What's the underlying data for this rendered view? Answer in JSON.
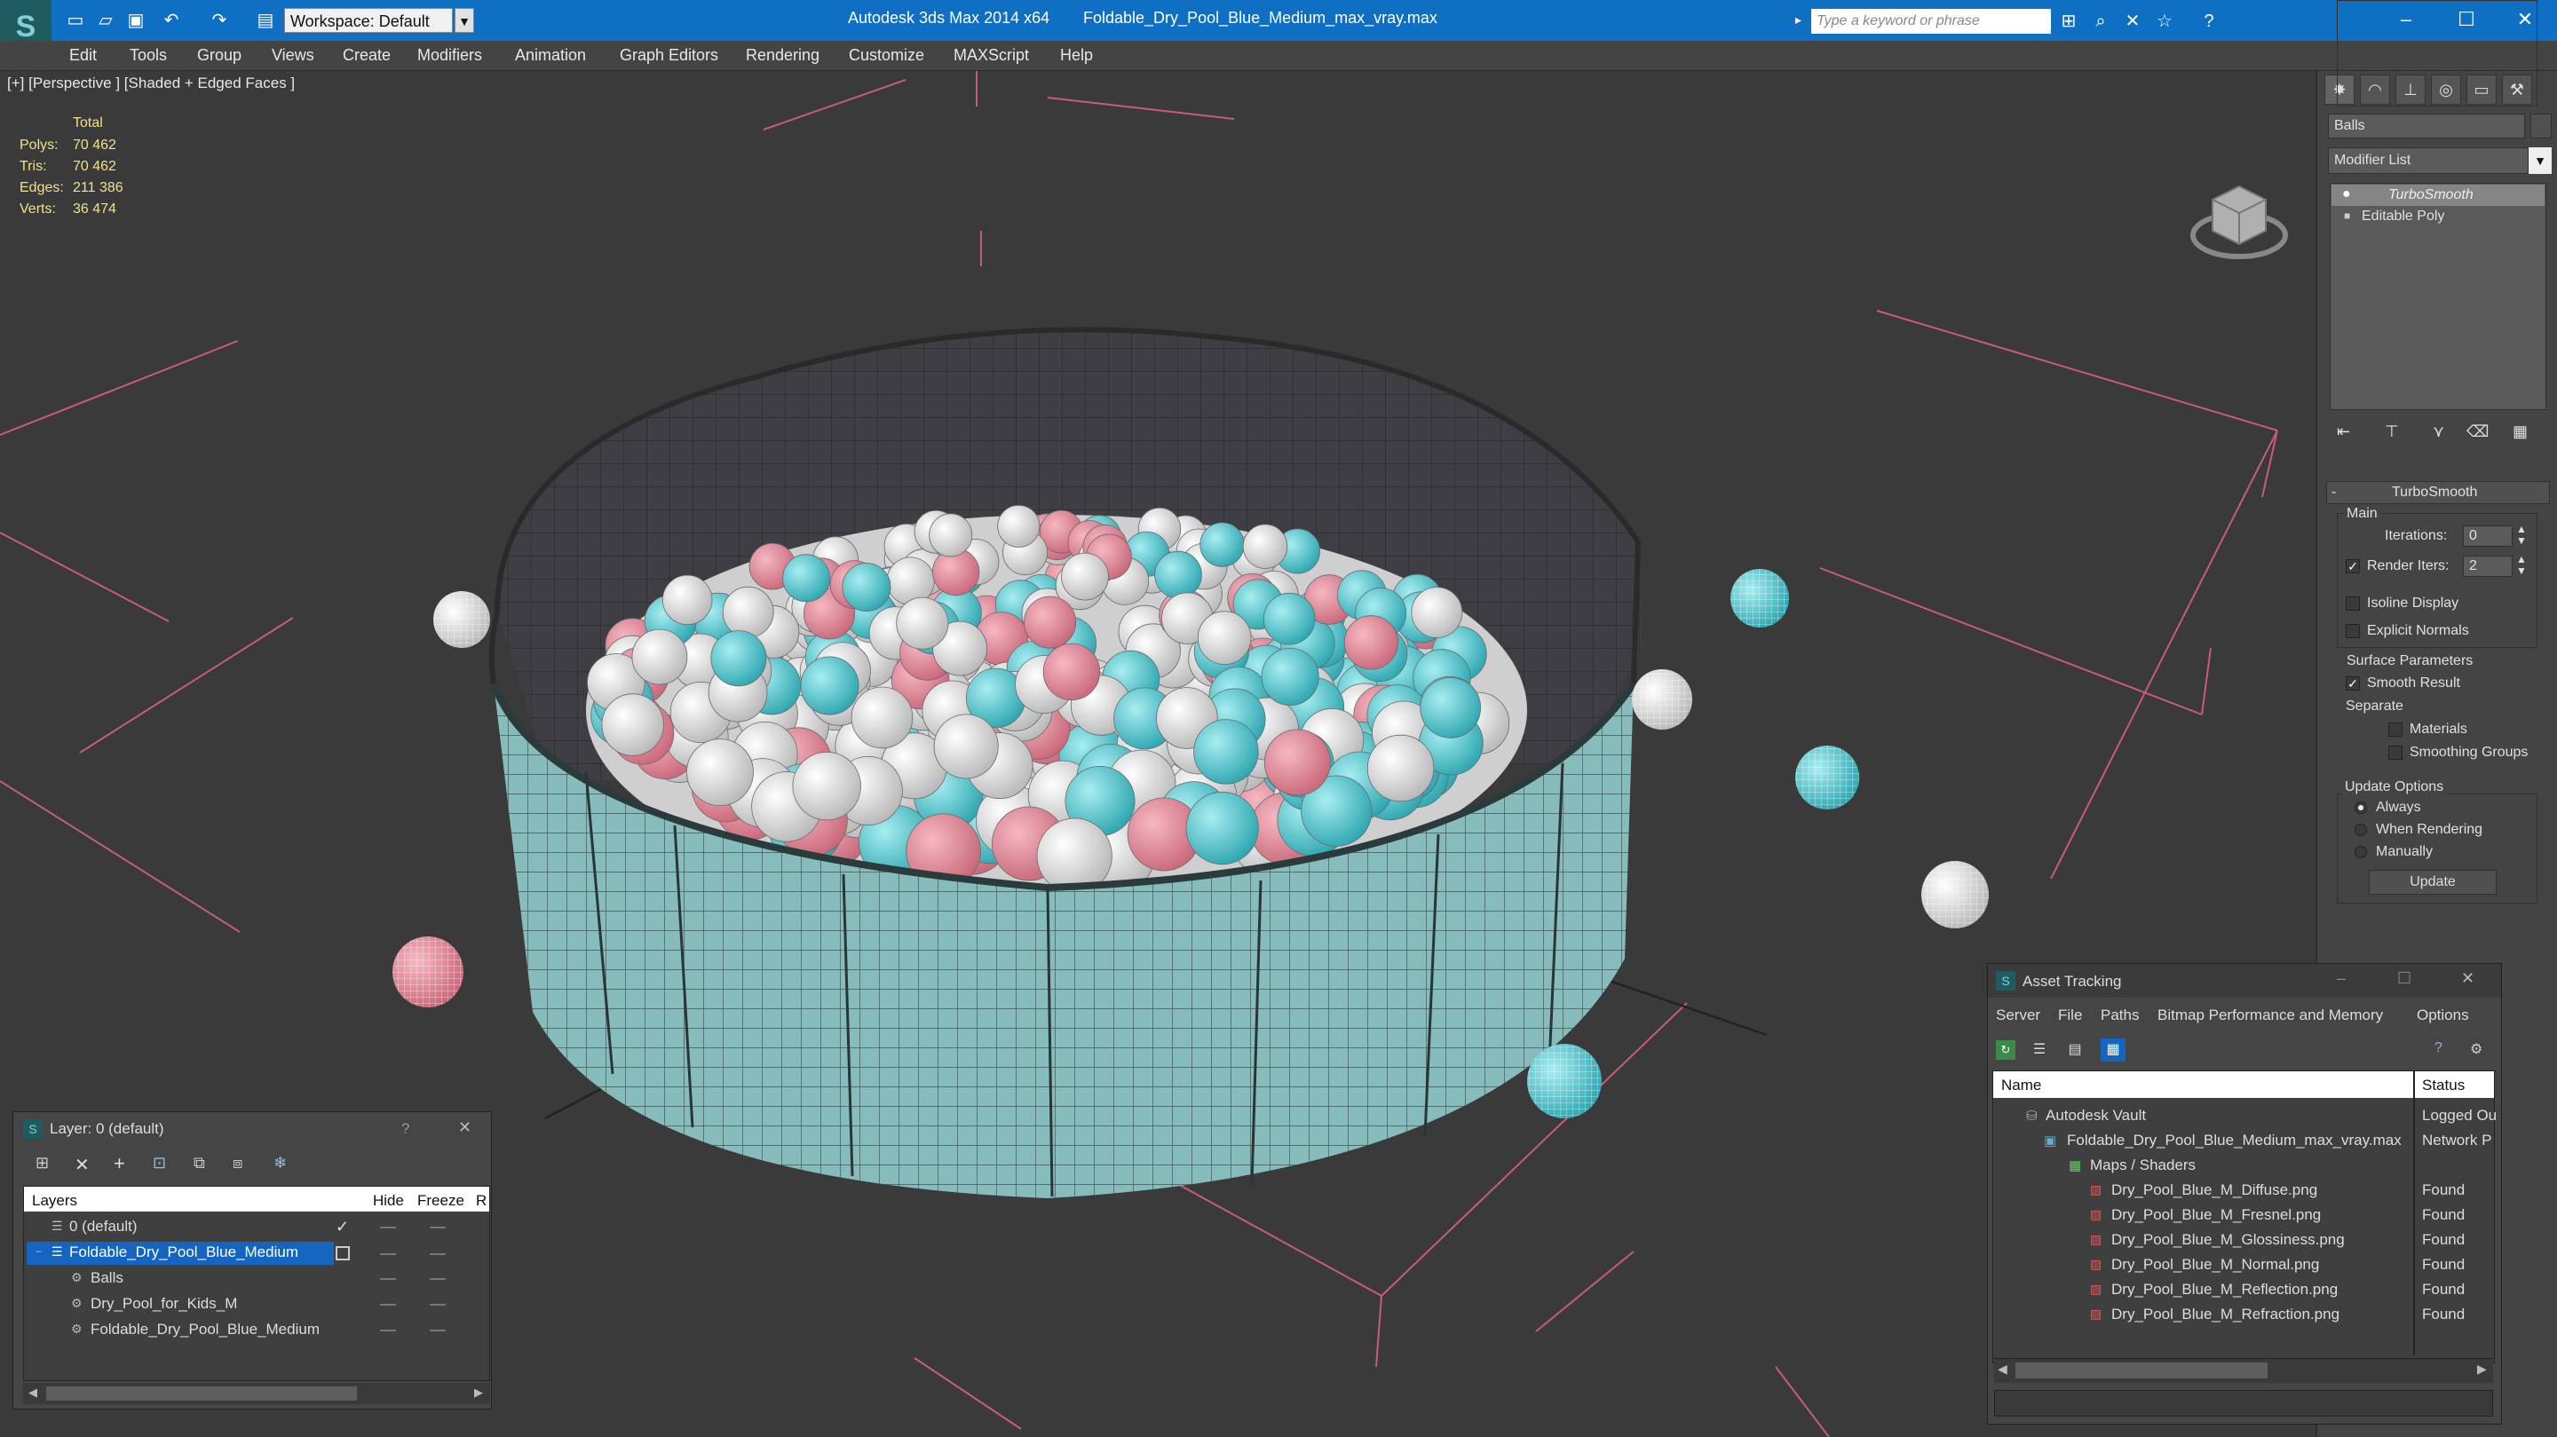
{
  "titlebar": {
    "workspace": "Workspace: Default",
    "app_title": "Autodesk 3ds Max  2014 x64",
    "file_title": "Foldable_Dry_Pool_Blue_Medium_max_vray.max",
    "search_placeholder": "Type a keyword or phrase"
  },
  "menu": [
    "Edit",
    "Tools",
    "Group",
    "Views",
    "Create",
    "Modifiers",
    "Animation",
    "Graph Editors",
    "Rendering",
    "Customize",
    "MAXScript",
    "Help"
  ],
  "viewport": {
    "label": "[+] [Perspective ] [Shaded + Edged Faces ]",
    "stats": {
      "header": "Total",
      "rows": [
        {
          "label": "Polys:",
          "value": "70 462"
        },
        {
          "label": "Tris:",
          "value": "70 462"
        },
        {
          "label": "Edges:",
          "value": "211 386"
        },
        {
          "label": "Verts:",
          "value": "36 474"
        }
      ]
    }
  },
  "command_panel": {
    "object_name": "Balls",
    "modifier_list": "Modifier List",
    "stack": [
      "TurboSmooth",
      "Editable Poly"
    ],
    "rollout_title": "TurboSmooth",
    "main_group": "Main",
    "iterations_label": "Iterations:",
    "iterations_value": "0",
    "render_iters_label": "Render Iters:",
    "render_iters_value": "2",
    "isoline": "Isoline Display",
    "explicit_normals": "Explicit Normals",
    "surface_params": "Surface Parameters",
    "smooth_result": "Smooth Result",
    "separate": "Separate",
    "materials": "Materials",
    "smoothing_groups": "Smoothing Groups",
    "update_options": "Update Options",
    "always": "Always",
    "when_rendering": "When Rendering",
    "manually": "Manually",
    "update_button": "Update"
  },
  "asset_tracking": {
    "title": "Asset Tracking",
    "menu": [
      "Server",
      "File",
      "Paths",
      "Bitmap Performance and Memory",
      "Options"
    ],
    "col_name": "Name",
    "col_status": "Status",
    "rows": [
      {
        "name": "Autodesk Vault",
        "status": "Logged Ou"
      },
      {
        "name": "Foldable_Dry_Pool_Blue_Medium_max_vray.max",
        "status": "Network P"
      },
      {
        "name": "Maps / Shaders",
        "status": ""
      },
      {
        "name": "Dry_Pool_Blue_M_Diffuse.png",
        "status": "Found"
      },
      {
        "name": "Dry_Pool_Blue_M_Fresnel.png",
        "status": "Found"
      },
      {
        "name": "Dry_Pool_Blue_M_Glossiness.png",
        "status": "Found"
      },
      {
        "name": "Dry_Pool_Blue_M_Normal.png",
        "status": "Found"
      },
      {
        "name": "Dry_Pool_Blue_M_Reflection.png",
        "status": "Found"
      },
      {
        "name": "Dry_Pool_Blue_M_Refraction.png",
        "status": "Found"
      }
    ]
  },
  "layer_explorer": {
    "title": "Layer: 0 (default)",
    "help": "?",
    "col_layers": "Layers",
    "col_hide": "Hide",
    "col_freeze": "Freeze",
    "col_r": "R",
    "rows": [
      {
        "name": "0 (default)"
      },
      {
        "name": "Foldable_Dry_Pool_Blue_Medium"
      },
      {
        "name": "Balls"
      },
      {
        "name": "Dry_Pool_for_Kids_M"
      },
      {
        "name": "Foldable_Dry_Pool_Blue_Medium"
      }
    ]
  },
  "colors": {
    "titlebar": "#0f6fc2",
    "selection": "#1565c0",
    "pool_wall": "#7fb8b8",
    "ball_pink": "#e88a99",
    "ball_cyan": "#4fc6cf",
    "ball_white": "#e4e4e4",
    "grid_line": "#d06a88"
  }
}
